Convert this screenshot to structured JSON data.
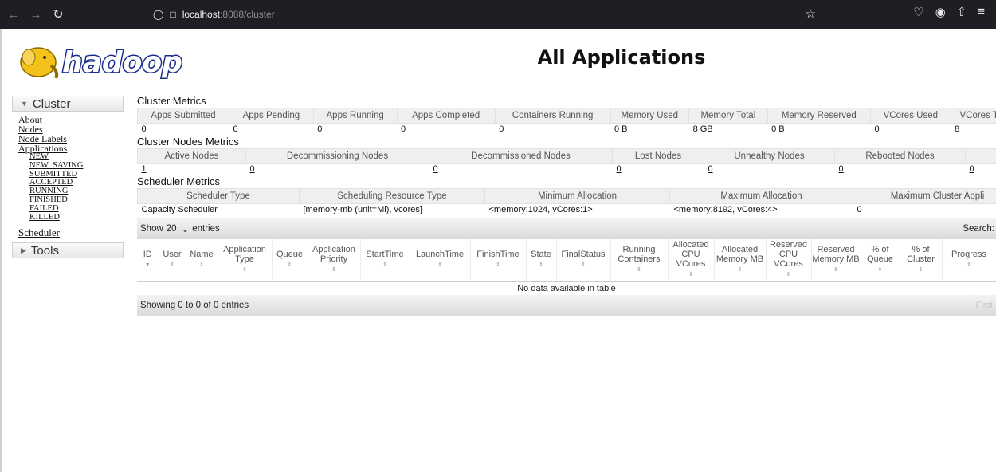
{
  "browser": {
    "url_host": "localhost",
    "url_rest": ":8088/cluster"
  },
  "header": {
    "logo_text": "hadoop",
    "title": "All Applications"
  },
  "nav": {
    "cluster_label": "Cluster",
    "cluster_links": [
      "About",
      "Nodes",
      "Node Labels",
      "Applications"
    ],
    "app_states": [
      "NEW",
      "NEW_SAVING",
      "SUBMITTED",
      "ACCEPTED",
      "RUNNING",
      "FINISHED",
      "FAILED",
      "KILLED"
    ],
    "scheduler": "Scheduler",
    "tools_label": "Tools"
  },
  "cluster_metrics": {
    "title": "Cluster Metrics",
    "headers": [
      "Apps Submitted",
      "Apps Pending",
      "Apps Running",
      "Apps Completed",
      "Containers Running",
      "Memory Used",
      "Memory Total",
      "Memory Reserved",
      "VCores Used",
      "VCores Total"
    ],
    "values": [
      "0",
      "0",
      "0",
      "0",
      "0",
      "0 B",
      "8 GB",
      "0 B",
      "0",
      "8"
    ]
  },
  "nodes_metrics": {
    "title": "Cluster Nodes Metrics",
    "headers": [
      "Active Nodes",
      "Decommissioning Nodes",
      "Decommissioned Nodes",
      "Lost Nodes",
      "Unhealthy Nodes",
      "Rebooted Nodes"
    ],
    "values": [
      "1",
      "0",
      "0",
      "0",
      "0",
      "0",
      "0"
    ]
  },
  "scheduler_metrics": {
    "title": "Scheduler Metrics",
    "headers": [
      "Scheduler Type",
      "Scheduling Resource Type",
      "Minimum Allocation",
      "Maximum Allocation",
      "Maximum Cluster Appli"
    ],
    "values": [
      "Capacity Scheduler",
      "[memory-mb (unit=Mi), vcores]",
      "<memory:1024, vCores:1>",
      "<memory:8192, vCores:4>",
      "0"
    ]
  },
  "apps": {
    "show_label": "Show",
    "page_size": "20",
    "entries_label": "entries",
    "search_label": "Search:",
    "columns": [
      "ID",
      "User",
      "Name",
      "Application Type",
      "Queue",
      "Application Priority",
      "StartTime",
      "LaunchTime",
      "FinishTime",
      "State",
      "FinalStatus",
      "Running Containers",
      "Allocated CPU VCores",
      "Allocated Memory MB",
      "Reserved CPU VCores",
      "Reserved Memory MB",
      "% of Queue",
      "% of Cluster",
      "Progress"
    ],
    "no_data": "No data available in table",
    "showing": "Showing 0 to 0 of 0 entries",
    "first_label": "First"
  },
  "colors": {
    "browser_bar": "#1f1e25",
    "header_bg": "#efefef",
    "logo_blue": "#1b2c8c",
    "logo_yellow": "#f4c21a"
  }
}
